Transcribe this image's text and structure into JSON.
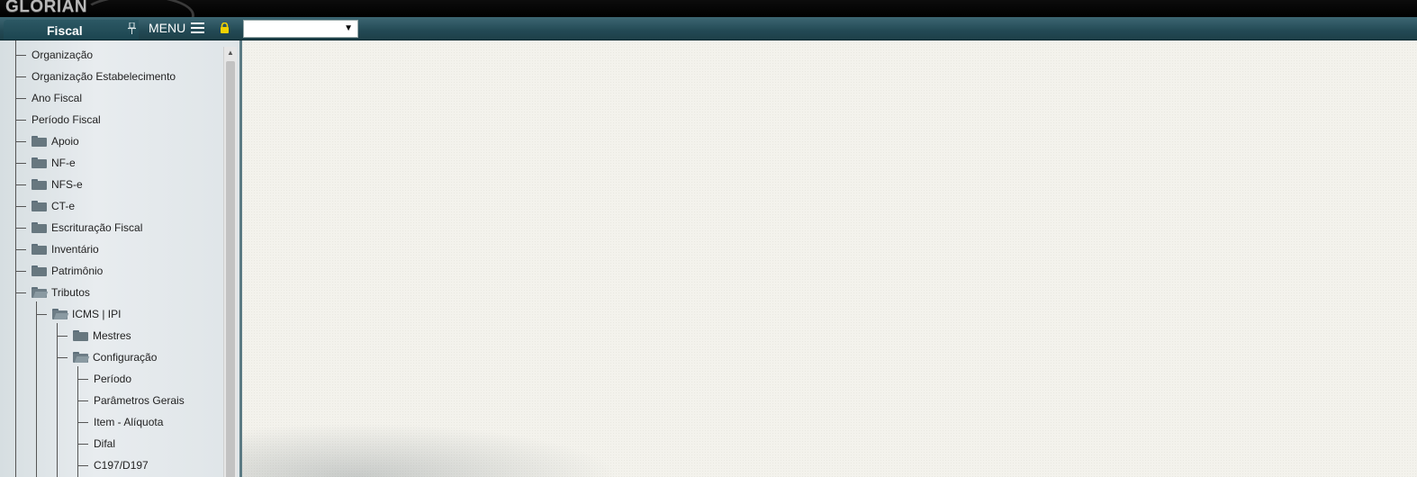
{
  "app": {
    "logo_text": "GLORIAN"
  },
  "header": {
    "module_title": "Fiscal",
    "menu_label": "MENU",
    "module_select_value": ""
  },
  "tree": [
    {
      "label": "Organização",
      "type": "item",
      "level": 0
    },
    {
      "label": "Organização Estabelecimento",
      "type": "item",
      "level": 0
    },
    {
      "label": "Ano Fiscal",
      "type": "item",
      "level": 0
    },
    {
      "label": "Período Fiscal",
      "type": "item",
      "level": 0
    },
    {
      "label": "Apoio",
      "type": "folder",
      "level": 0
    },
    {
      "label": "NF-e",
      "type": "folder",
      "level": 0
    },
    {
      "label": "NFS-e",
      "type": "folder",
      "level": 0
    },
    {
      "label": "CT-e",
      "type": "folder",
      "level": 0
    },
    {
      "label": "Escrituração Fiscal",
      "type": "folder",
      "level": 0
    },
    {
      "label": "Inventário",
      "type": "folder",
      "level": 0
    },
    {
      "label": "Patrimônio",
      "type": "folder",
      "level": 0
    },
    {
      "label": "Tributos",
      "type": "folder-open",
      "level": 0
    },
    {
      "label": "ICMS | IPI",
      "type": "folder-open",
      "level": 1
    },
    {
      "label": "Mestres",
      "type": "folder",
      "level": 2
    },
    {
      "label": "Configuração",
      "type": "folder-open",
      "level": 2
    },
    {
      "label": "Período",
      "type": "item",
      "level": 3
    },
    {
      "label": "Parâmetros Gerais",
      "type": "item",
      "level": 3
    },
    {
      "label": "Item - Alíquota",
      "type": "item",
      "level": 3
    },
    {
      "label": "Difal",
      "type": "item",
      "level": 3
    },
    {
      "label": "C197/D197",
      "type": "item",
      "level": 3
    }
  ],
  "icons": {
    "pin": "pin-icon",
    "menu": "hamburger-icon",
    "lock": "lock-icon",
    "folder": "folder-icon",
    "folder_open": "folder-open-icon"
  },
  "colors": {
    "header_bar": "#234a55",
    "top_bar": "#000000",
    "sidebar_bg": "#e3e8eb",
    "main_bg": "#f3f2ec",
    "lock": "#f2d200"
  }
}
